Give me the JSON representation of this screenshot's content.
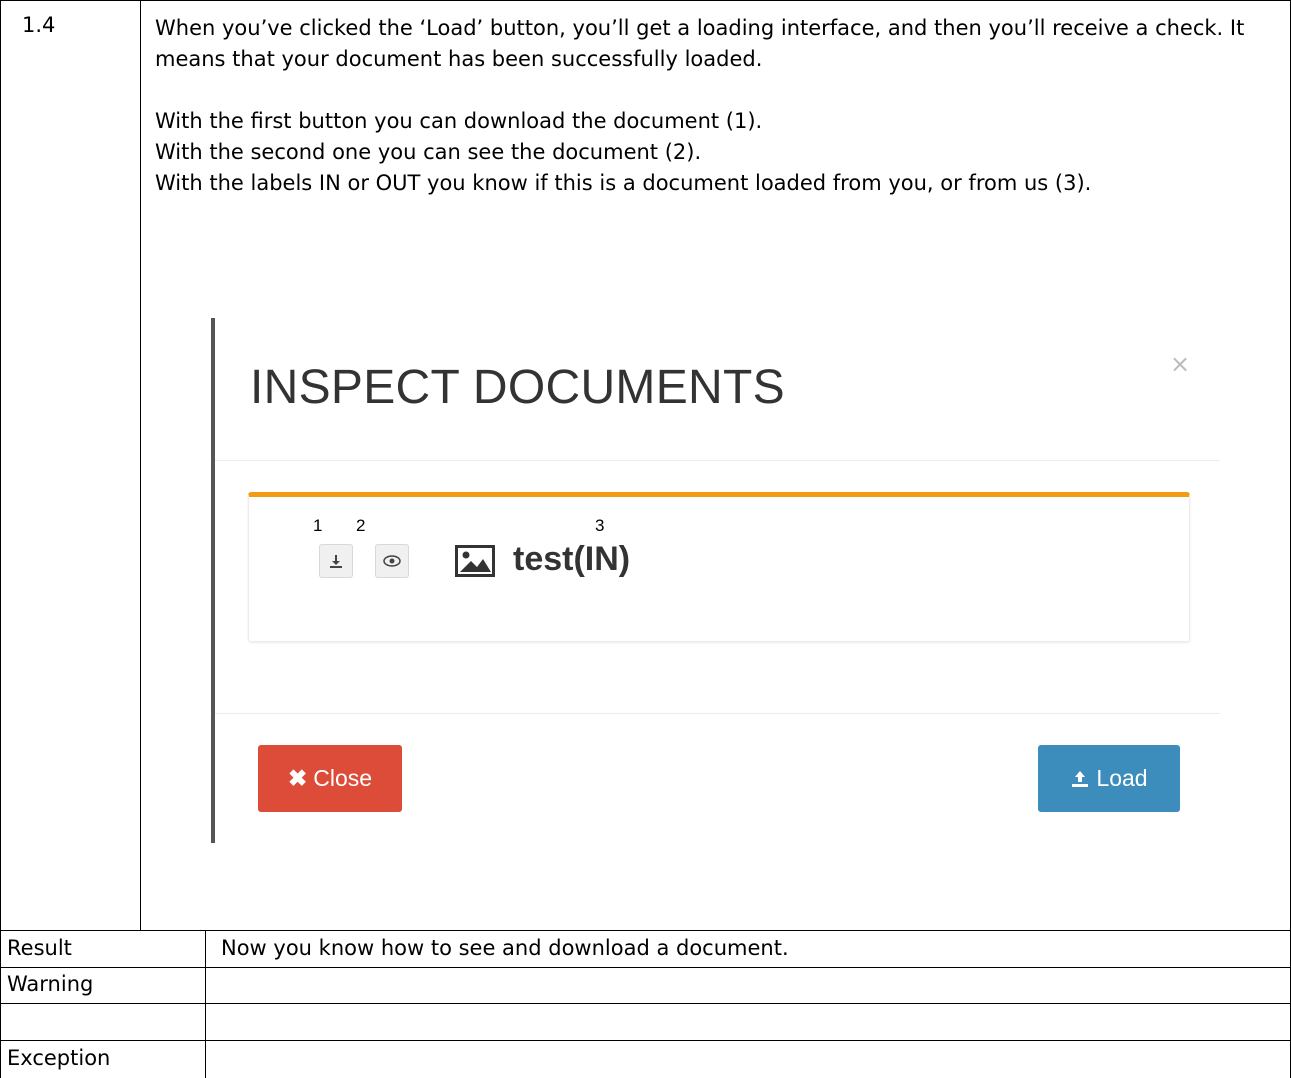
{
  "step": {
    "number": "1.4",
    "para1": "When you’ve clicked the ‘Load’ button, you’ll get a loading interface, and then you’ll receive a check. It means that your document has been successfully loaded.",
    "line1": "With the first button you can download the document (1).",
    "line2": "With the second one you can see the document (2).",
    "line3": "With the labels IN or OUT you know if this is a document loaded from you, or from us (3)."
  },
  "screenshot": {
    "title": "INSPECT DOCUMENTS",
    "close_x": "×",
    "annotations": [
      "1",
      "2",
      "3"
    ],
    "document_name": "test(IN)",
    "close_button_label": "Close",
    "load_button_label": "Load",
    "accent_color": "#f39c12",
    "close_color": "#dd4b39",
    "load_color": "#3c8dbc",
    "icons": [
      "download-icon",
      "eye-icon",
      "image-icon",
      "times-icon",
      "upload-icon"
    ]
  },
  "rows": [
    {
      "label": "Result",
      "value": "Now you know how to see and download a document."
    },
    {
      "label": "Warning",
      "value": ""
    },
    {
      "label": "Exception",
      "value": ""
    }
  ]
}
